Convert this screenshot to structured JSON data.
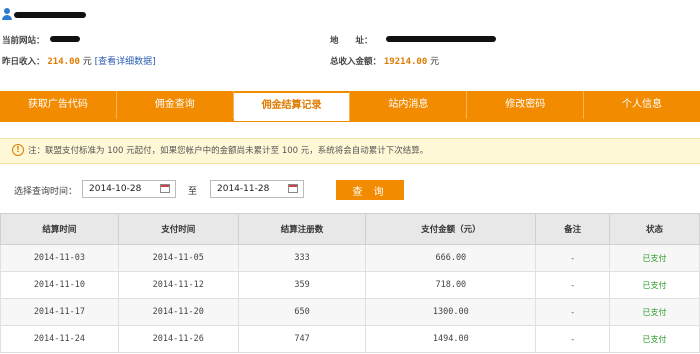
{
  "header": {
    "site_label": "当前网站：",
    "address_label": "地　　址：",
    "yesterday_label": "昨日收入：",
    "yesterday_value": "214.00",
    "yesterday_unit": "元",
    "detail_link": "[查看详细数据]",
    "total_label": "总收入金额：",
    "total_value": "19214.00",
    "total_unit": "元"
  },
  "tabs": [
    {
      "label": "获取广告代码"
    },
    {
      "label": "佣金查询"
    },
    {
      "label": "佣金结算记录"
    },
    {
      "label": "站内消息"
    },
    {
      "label": "修改密码"
    },
    {
      "label": "个人信息"
    }
  ],
  "notice": {
    "text": "注：联盟支付标准为 100 元起付，如果您帐户中的金额尚未累计至 100 元，系统将会自动累计下次结算。"
  },
  "filter": {
    "label": "选择查询时间：",
    "start": "2014-10-28",
    "separator": "至",
    "end": "2014-11-28",
    "button": "查 询"
  },
  "table": {
    "headers": [
      "结算时间",
      "支付时间",
      "结算注册数",
      "支付金额（元）",
      "备注",
      "状态"
    ],
    "rows": [
      [
        "2014-11-03",
        "2014-11-05",
        "333",
        "666.00",
        "-",
        "已支付"
      ],
      [
        "2014-11-10",
        "2014-11-12",
        "359",
        "718.00",
        "-",
        "已支付"
      ],
      [
        "2014-11-17",
        "2014-11-20",
        "650",
        "1300.00",
        "-",
        "已支付"
      ],
      [
        "2014-11-24",
        "2014-11-26",
        "747",
        "1494.00",
        "-",
        "已支付"
      ]
    ]
  },
  "colors": {
    "accent": "#f28b00",
    "paid": "#2c9a2c",
    "link": "#2a5db0"
  }
}
